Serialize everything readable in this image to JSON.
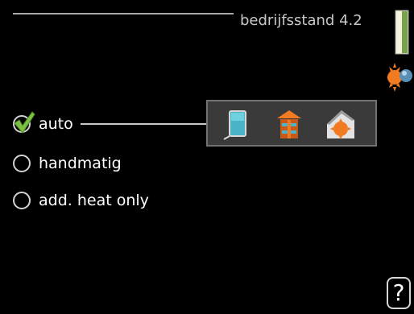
{
  "header": {
    "title": "bedrijfsstand 4.2"
  },
  "options": [
    {
      "id": "auto",
      "label": "auto",
      "selected": true
    },
    {
      "id": "handmatig",
      "label": "handmatig",
      "selected": false
    },
    {
      "id": "add-heat-only",
      "label": "add. heat only",
      "selected": false
    }
  ],
  "icons": {
    "side": [
      "thermometer-bar-icon",
      "sun-globe-icon"
    ],
    "panel": [
      "pool-icon",
      "house-heating-icon",
      "house-sun-icon"
    ],
    "selected_check": "checkmark-icon"
  },
  "help": {
    "label": "?"
  },
  "colors": {
    "background": "#000000",
    "text": "#ffffff",
    "header_text": "#c8c8c8",
    "panel_background": "#3a3a3a",
    "panel_border": "#727272",
    "check_green": "#7cc242",
    "accent_orange": "#f27a21",
    "accent_teal": "#4bb3c6"
  }
}
